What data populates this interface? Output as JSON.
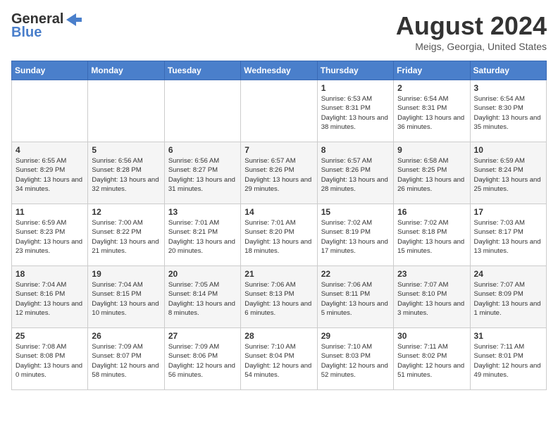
{
  "header": {
    "logo_line1": "General",
    "logo_line2": "Blue",
    "month_title": "August 2024",
    "subtitle": "Meigs, Georgia, United States"
  },
  "days_of_week": [
    "Sunday",
    "Monday",
    "Tuesday",
    "Wednesday",
    "Thursday",
    "Friday",
    "Saturday"
  ],
  "weeks": [
    [
      {
        "day": "",
        "info": ""
      },
      {
        "day": "",
        "info": ""
      },
      {
        "day": "",
        "info": ""
      },
      {
        "day": "",
        "info": ""
      },
      {
        "day": "1",
        "info": "Sunrise: 6:53 AM\nSunset: 8:31 PM\nDaylight: 13 hours and 38 minutes."
      },
      {
        "day": "2",
        "info": "Sunrise: 6:54 AM\nSunset: 8:31 PM\nDaylight: 13 hours and 36 minutes."
      },
      {
        "day": "3",
        "info": "Sunrise: 6:54 AM\nSunset: 8:30 PM\nDaylight: 13 hours and 35 minutes."
      }
    ],
    [
      {
        "day": "4",
        "info": "Sunrise: 6:55 AM\nSunset: 8:29 PM\nDaylight: 13 hours and 34 minutes."
      },
      {
        "day": "5",
        "info": "Sunrise: 6:56 AM\nSunset: 8:28 PM\nDaylight: 13 hours and 32 minutes."
      },
      {
        "day": "6",
        "info": "Sunrise: 6:56 AM\nSunset: 8:27 PM\nDaylight: 13 hours and 31 minutes."
      },
      {
        "day": "7",
        "info": "Sunrise: 6:57 AM\nSunset: 8:26 PM\nDaylight: 13 hours and 29 minutes."
      },
      {
        "day": "8",
        "info": "Sunrise: 6:57 AM\nSunset: 8:26 PM\nDaylight: 13 hours and 28 minutes."
      },
      {
        "day": "9",
        "info": "Sunrise: 6:58 AM\nSunset: 8:25 PM\nDaylight: 13 hours and 26 minutes."
      },
      {
        "day": "10",
        "info": "Sunrise: 6:59 AM\nSunset: 8:24 PM\nDaylight: 13 hours and 25 minutes."
      }
    ],
    [
      {
        "day": "11",
        "info": "Sunrise: 6:59 AM\nSunset: 8:23 PM\nDaylight: 13 hours and 23 minutes."
      },
      {
        "day": "12",
        "info": "Sunrise: 7:00 AM\nSunset: 8:22 PM\nDaylight: 13 hours and 21 minutes."
      },
      {
        "day": "13",
        "info": "Sunrise: 7:01 AM\nSunset: 8:21 PM\nDaylight: 13 hours and 20 minutes."
      },
      {
        "day": "14",
        "info": "Sunrise: 7:01 AM\nSunset: 8:20 PM\nDaylight: 13 hours and 18 minutes."
      },
      {
        "day": "15",
        "info": "Sunrise: 7:02 AM\nSunset: 8:19 PM\nDaylight: 13 hours and 17 minutes."
      },
      {
        "day": "16",
        "info": "Sunrise: 7:02 AM\nSunset: 8:18 PM\nDaylight: 13 hours and 15 minutes."
      },
      {
        "day": "17",
        "info": "Sunrise: 7:03 AM\nSunset: 8:17 PM\nDaylight: 13 hours and 13 minutes."
      }
    ],
    [
      {
        "day": "18",
        "info": "Sunrise: 7:04 AM\nSunset: 8:16 PM\nDaylight: 13 hours and 12 minutes."
      },
      {
        "day": "19",
        "info": "Sunrise: 7:04 AM\nSunset: 8:15 PM\nDaylight: 13 hours and 10 minutes."
      },
      {
        "day": "20",
        "info": "Sunrise: 7:05 AM\nSunset: 8:14 PM\nDaylight: 13 hours and 8 minutes."
      },
      {
        "day": "21",
        "info": "Sunrise: 7:06 AM\nSunset: 8:13 PM\nDaylight: 13 hours and 6 minutes."
      },
      {
        "day": "22",
        "info": "Sunrise: 7:06 AM\nSunset: 8:11 PM\nDaylight: 13 hours and 5 minutes."
      },
      {
        "day": "23",
        "info": "Sunrise: 7:07 AM\nSunset: 8:10 PM\nDaylight: 13 hours and 3 minutes."
      },
      {
        "day": "24",
        "info": "Sunrise: 7:07 AM\nSunset: 8:09 PM\nDaylight: 13 hours and 1 minute."
      }
    ],
    [
      {
        "day": "25",
        "info": "Sunrise: 7:08 AM\nSunset: 8:08 PM\nDaylight: 13 hours and 0 minutes."
      },
      {
        "day": "26",
        "info": "Sunrise: 7:09 AM\nSunset: 8:07 PM\nDaylight: 12 hours and 58 minutes."
      },
      {
        "day": "27",
        "info": "Sunrise: 7:09 AM\nSunset: 8:06 PM\nDaylight: 12 hours and 56 minutes."
      },
      {
        "day": "28",
        "info": "Sunrise: 7:10 AM\nSunset: 8:04 PM\nDaylight: 12 hours and 54 minutes."
      },
      {
        "day": "29",
        "info": "Sunrise: 7:10 AM\nSunset: 8:03 PM\nDaylight: 12 hours and 52 minutes."
      },
      {
        "day": "30",
        "info": "Sunrise: 7:11 AM\nSunset: 8:02 PM\nDaylight: 12 hours and 51 minutes."
      },
      {
        "day": "31",
        "info": "Sunrise: 7:11 AM\nSunset: 8:01 PM\nDaylight: 12 hours and 49 minutes."
      }
    ]
  ]
}
